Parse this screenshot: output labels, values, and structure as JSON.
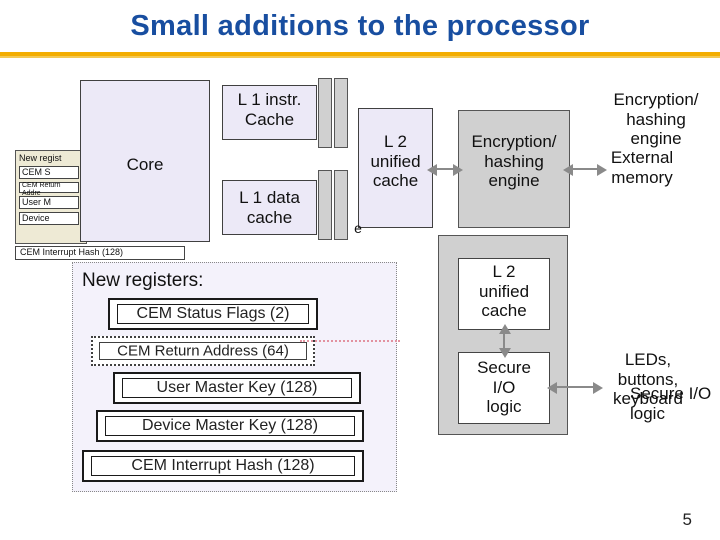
{
  "title": "Small additions to the processor",
  "slide_number": "5",
  "top": {
    "core": "Core",
    "l1_instr": "L 1 instr.\nCache",
    "l1_data": "L 1 data\ncache",
    "l2_left": "L 2\nunified\ncache",
    "enc_mid": "Encryption/\nhashing\nengine",
    "enc_right": "Encryption/\nhashing\nengine",
    "ext_mem": "External\nmemory",
    "l2_lower": "L 2\nunified\ncache",
    "sec_io_left": "Secure\nI/O\nlogic",
    "sec_io_right": "Secure I/O\nlogic",
    "leds": "LEDs,\nbuttons,\nkeyboard",
    "cache_fragment": "e"
  },
  "mini": {
    "title": "New regist",
    "items": [
      "CEM S",
      "CEM Return Addre",
      "User M",
      "Device",
      "CEM Interrupt Hash (128)"
    ]
  },
  "panel": {
    "title": "New registers:",
    "rows": [
      "CEM Status Flags (2)",
      "CEM Return Address (64)",
      "User Master Key (128)",
      "Device Master Key (128)",
      "CEM Interrupt Hash (128)"
    ]
  },
  "chart_data": {
    "type": "diagram",
    "title": "Small additions to the processor",
    "nodes": [
      {
        "id": "core",
        "label": "Core"
      },
      {
        "id": "l1i",
        "label": "L1 instr. Cache"
      },
      {
        "id": "l1d",
        "label": "L1 data cache"
      },
      {
        "id": "l2a",
        "label": "L2 unified cache"
      },
      {
        "id": "enc1",
        "label": "Encryption / hashing engine"
      },
      {
        "id": "extmem",
        "label": "External memory"
      },
      {
        "id": "l2b",
        "label": "L2 unified cache"
      },
      {
        "id": "secio1",
        "label": "Secure I/O logic"
      },
      {
        "id": "secio2",
        "label": "Secure I/O logic"
      },
      {
        "id": "io",
        "label": "LEDs, buttons, keyboard"
      }
    ],
    "edges": [
      [
        "core",
        "l1i"
      ],
      [
        "core",
        "l1d"
      ],
      [
        "l1i",
        "l2a"
      ],
      [
        "l1d",
        "l2a"
      ],
      [
        "l2a",
        "enc1"
      ],
      [
        "enc1",
        "extmem"
      ],
      [
        "l2a",
        "l2b"
      ],
      [
        "l2b",
        "secio1"
      ],
      [
        "secio1",
        "io"
      ],
      [
        "io",
        "secio2"
      ]
    ],
    "new_registers": [
      "CEM Status Flags (2)",
      "CEM Return Address (64)",
      "User Master Key (128)",
      "Device Master Key (128)",
      "CEM Interrupt Hash (128)"
    ]
  }
}
